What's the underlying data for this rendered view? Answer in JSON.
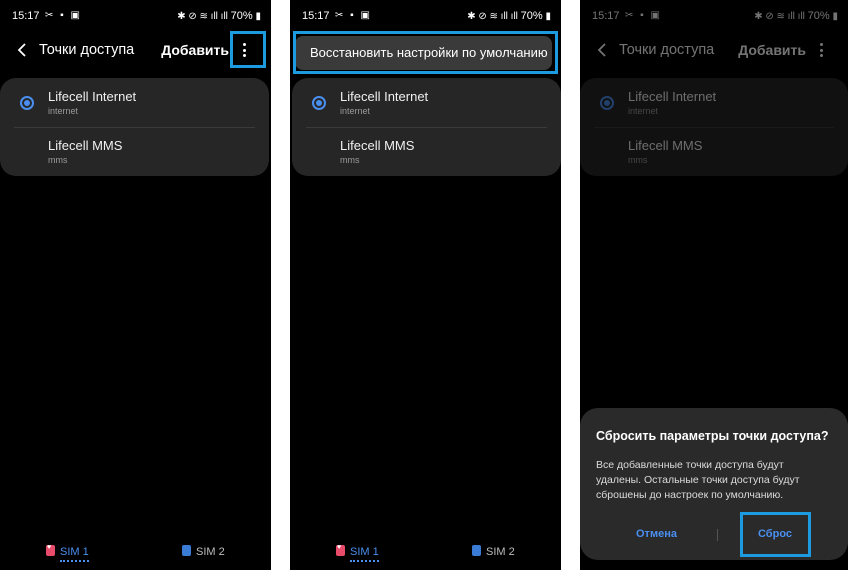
{
  "status": {
    "time": "15:17",
    "left_icons": "✂ ▪ ▣",
    "right_icons": "✱ ⊘ ≋ ıll ıll",
    "battery": "70%",
    "battery_icon": "▮"
  },
  "appbar": {
    "title": "Точки доступа",
    "add_label": "Добавить",
    "back_icon": "chevron-left-icon",
    "more_icon": "more-vertical-icon"
  },
  "access_points": [
    {
      "name": "Lifecell Internet",
      "sub": "internet",
      "selected": true
    },
    {
      "name": "Lifecell MMS",
      "sub": "mms",
      "selected": false
    }
  ],
  "sim": {
    "sim1_label": "SIM 1",
    "sim2_label": "SIM 2"
  },
  "menu": {
    "reset_label": "Восстановить настройки по умолчанию"
  },
  "dialog": {
    "title": "Сбросить параметры точки доступа?",
    "body": "Все добавленные точки доступа будут удалены. Остальные точки доступа будут сброшены до настроек по умолчанию.",
    "cancel_label": "Отмена",
    "ok_label": "Сброс"
  },
  "colors": {
    "accent": "#4a8ff0",
    "highlight": "#1d9be0",
    "card": "#262626",
    "background": "#000000"
  }
}
